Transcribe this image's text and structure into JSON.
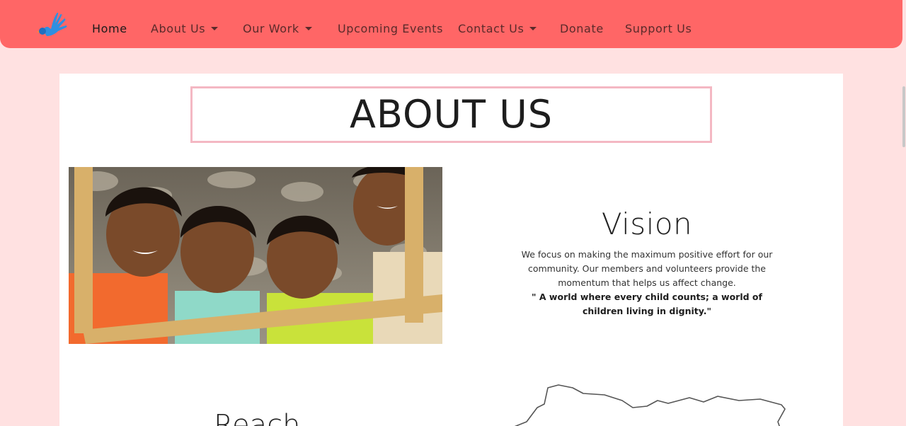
{
  "nav": {
    "items": [
      {
        "label": "Home",
        "active": true,
        "dropdown": false
      },
      {
        "label": "About Us",
        "active": false,
        "dropdown": true
      },
      {
        "label": "Our Work",
        "active": false,
        "dropdown": true
      },
      {
        "label": "Upcoming Events",
        "active": false,
        "dropdown": false
      },
      {
        "label": "Contact Us",
        "active": false,
        "dropdown": true
      },
      {
        "label": "Donate",
        "active": false,
        "dropdown": false
      },
      {
        "label": "Support Us",
        "active": false,
        "dropdown": false
      }
    ]
  },
  "page": {
    "title": "ABOUT US"
  },
  "vision": {
    "heading": "Vision",
    "text": "We focus on making the maximum positive effort for our community. Our members and volunteers provide the momentum that helps us affect change.",
    "quote": "\" A world where every child counts; a world of children living in dignity.\""
  },
  "reach": {
    "heading": "Reach"
  },
  "colors": {
    "navbar": "#ff6666",
    "page_bg": "#ffe1e1",
    "title_border": "#f4b8c3",
    "logo": "#2f8fe0"
  },
  "icons": {
    "logo": "hand-bird-logo-icon"
  }
}
